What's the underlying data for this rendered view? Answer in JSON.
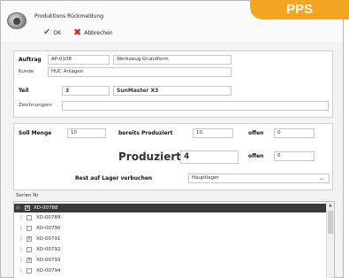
{
  "window": {
    "title": "Produktions Rückmeldung"
  },
  "toolbar": {
    "ok_label": "OK",
    "cancel_label": "Abbrechen"
  },
  "badge": {
    "label": "PPS",
    "color": "#f4a621"
  },
  "order": {
    "auftrag_label": "Auftrag",
    "auftrag_value": "AP-0108",
    "auftrag_desc": "Werkzeug Grundform",
    "kunde_label": "Kunde",
    "kunde_value": "HUC Anlagen",
    "teil_label": "Teil",
    "teil_value": "3",
    "teil_desc": "SunMaster X3",
    "zeichnung_label": "Zeichnungsnr",
    "zeichnung_value": ""
  },
  "quantities": {
    "soll_label": "Soll Menge",
    "soll_value": "10",
    "bereits_label": "bereits Produziert",
    "bereits_value": "10",
    "offen_label": "offen",
    "offen_value": "0",
    "produziert_label": "Produziert",
    "produziert_value": "4",
    "offen2_label": "offen",
    "offen2_value": "0",
    "rest_label": "Rest auf Lager verbuchen",
    "rest_value": "Hauptlager"
  },
  "serials": {
    "label": "Serien Nr",
    "items": [
      {
        "label": "XD-00788",
        "checked": true,
        "selected": true
      },
      {
        "label": "XD-00789",
        "checked": false,
        "selected": false
      },
      {
        "label": "XD-00790",
        "checked": false,
        "selected": false
      },
      {
        "label": "XD-00791",
        "checked": true,
        "selected": false
      },
      {
        "label": "XD-00792",
        "checked": false,
        "selected": false
      },
      {
        "label": "XD-00793",
        "checked": true,
        "selected": false
      },
      {
        "label": "XD-00794",
        "checked": false,
        "selected": false
      }
    ]
  }
}
